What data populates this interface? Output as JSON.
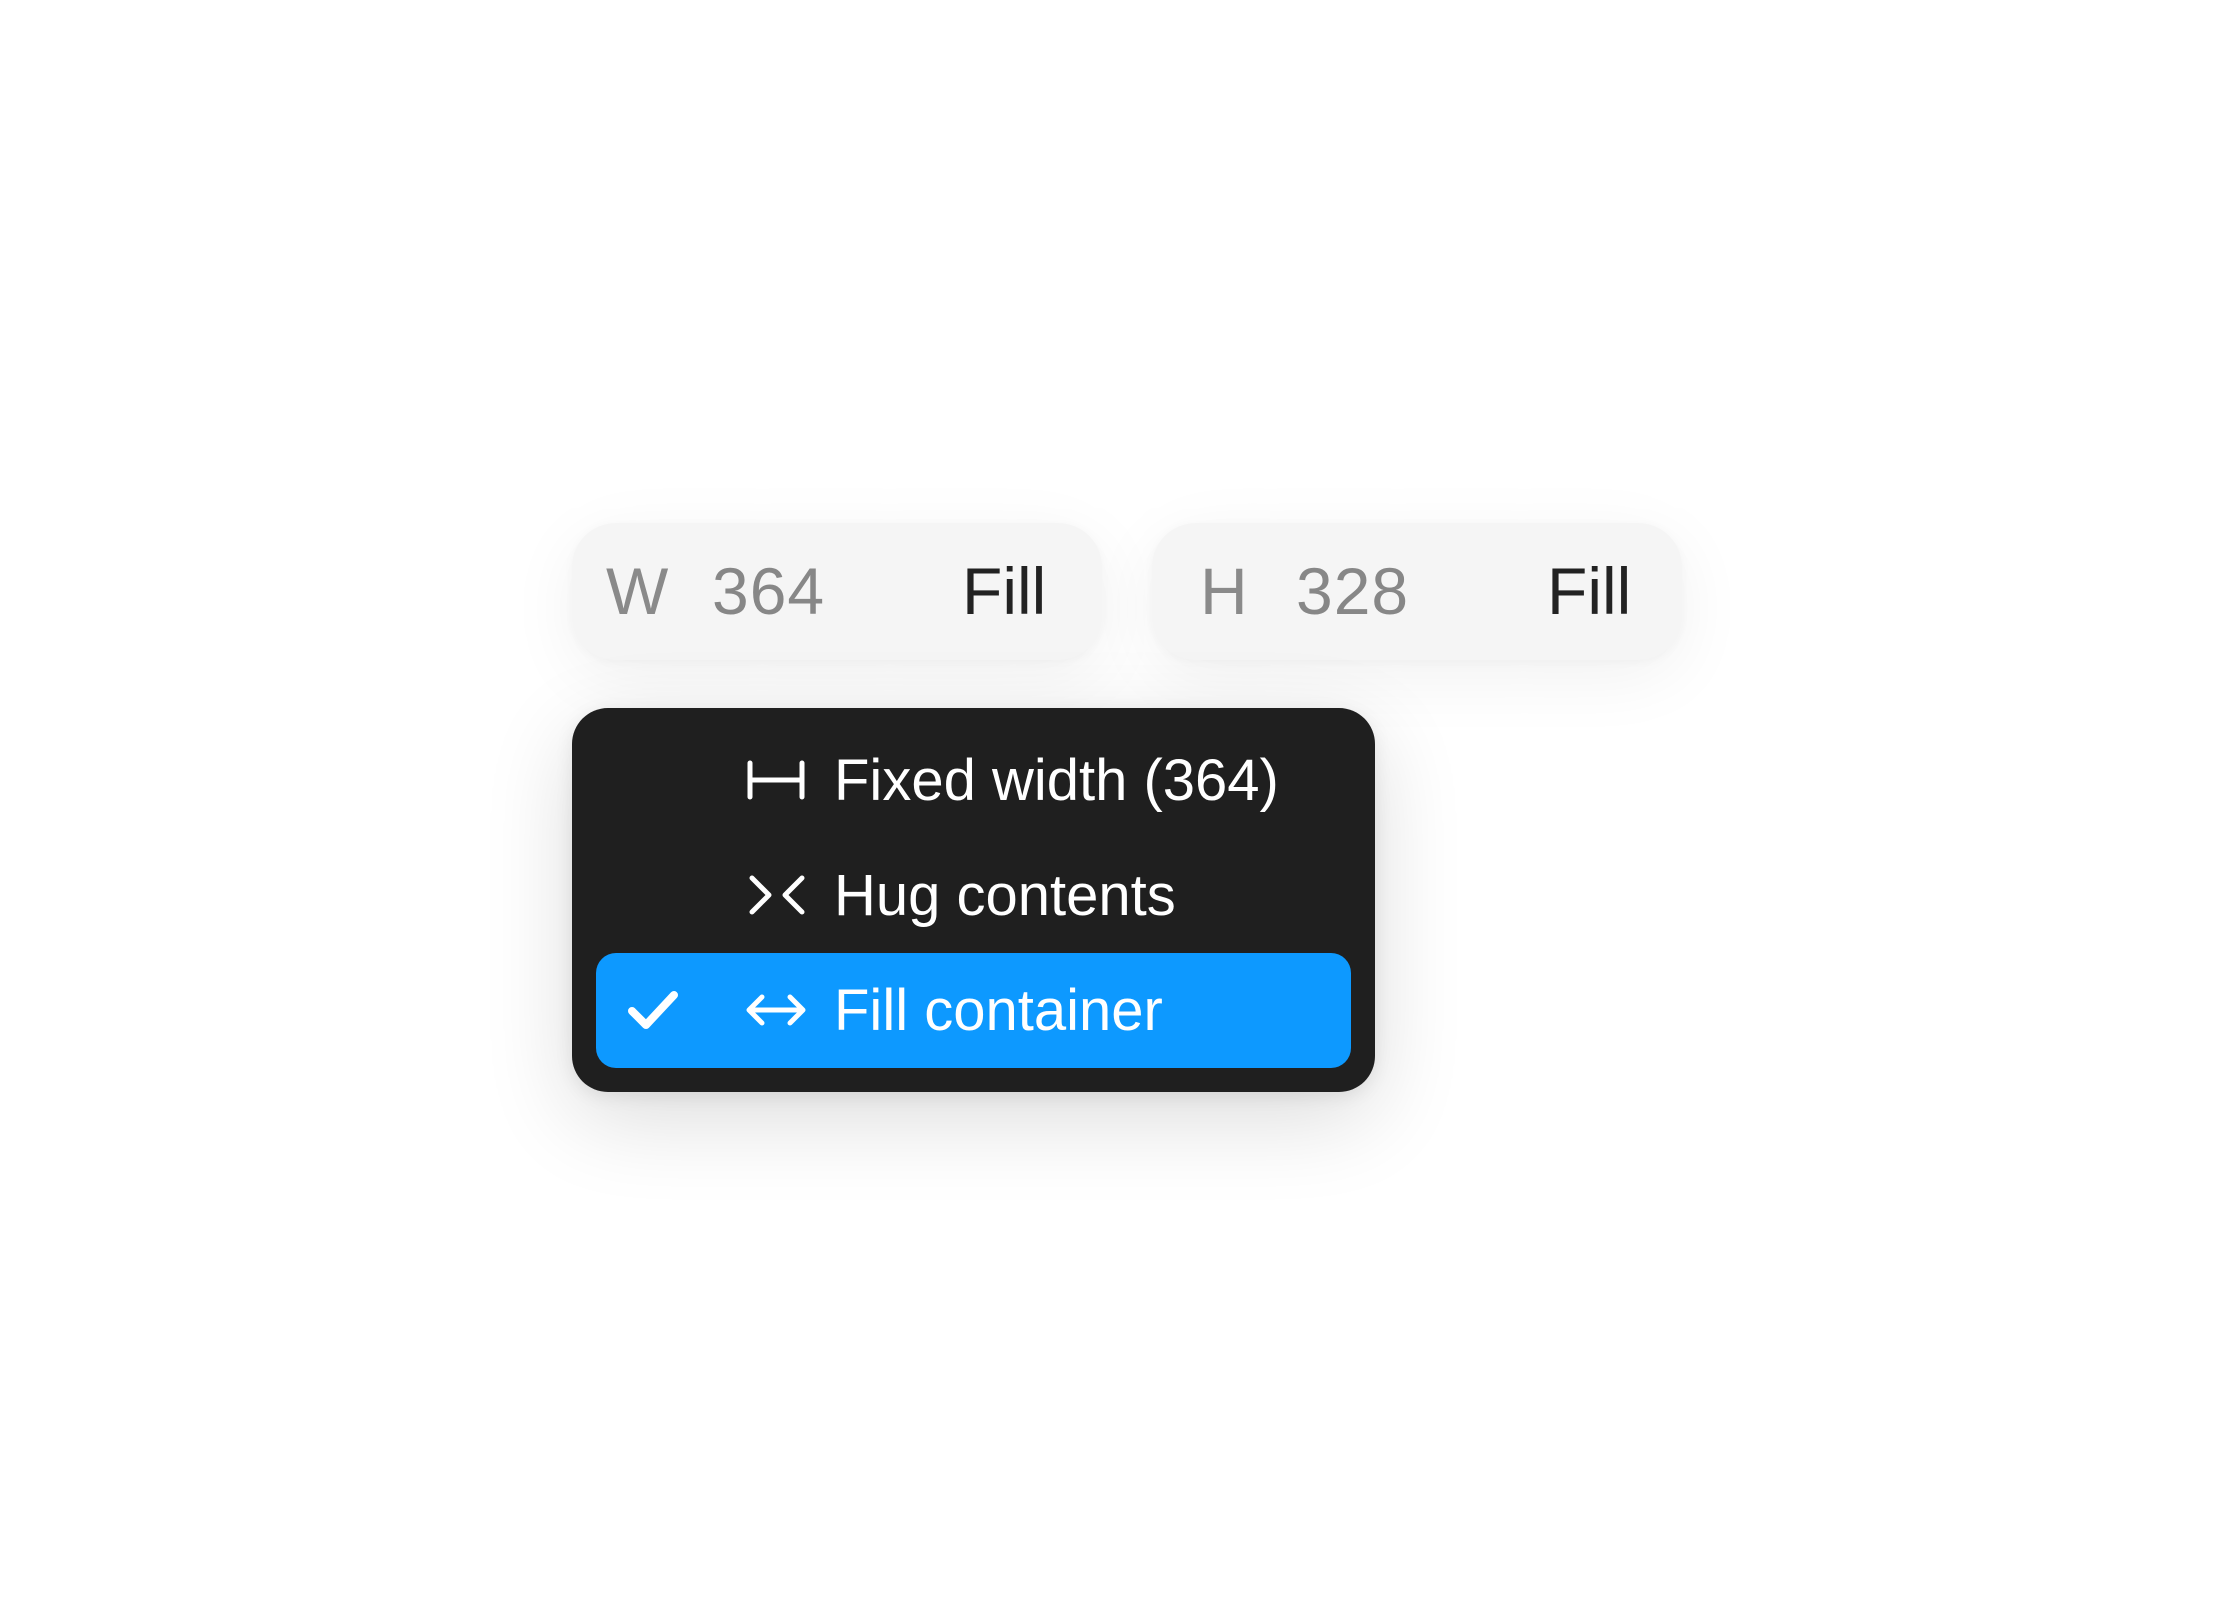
{
  "width_field": {
    "axis": "W",
    "value": "364",
    "mode": "Fill"
  },
  "height_field": {
    "axis": "H",
    "value": "328",
    "mode": "Fill"
  },
  "sizing_menu": {
    "items": [
      {
        "label": "Fixed width (364)",
        "icon": "fixed-width-icon",
        "selected": false
      },
      {
        "label": "Hug contents",
        "icon": "hug-contents-icon",
        "selected": false
      },
      {
        "label": "Fill container",
        "icon": "fill-container-icon",
        "selected": true
      }
    ]
  },
  "colors": {
    "menu_background": "#1f1f1f",
    "selected_item": "#0d99ff",
    "field_background": "#f5f5f5"
  }
}
